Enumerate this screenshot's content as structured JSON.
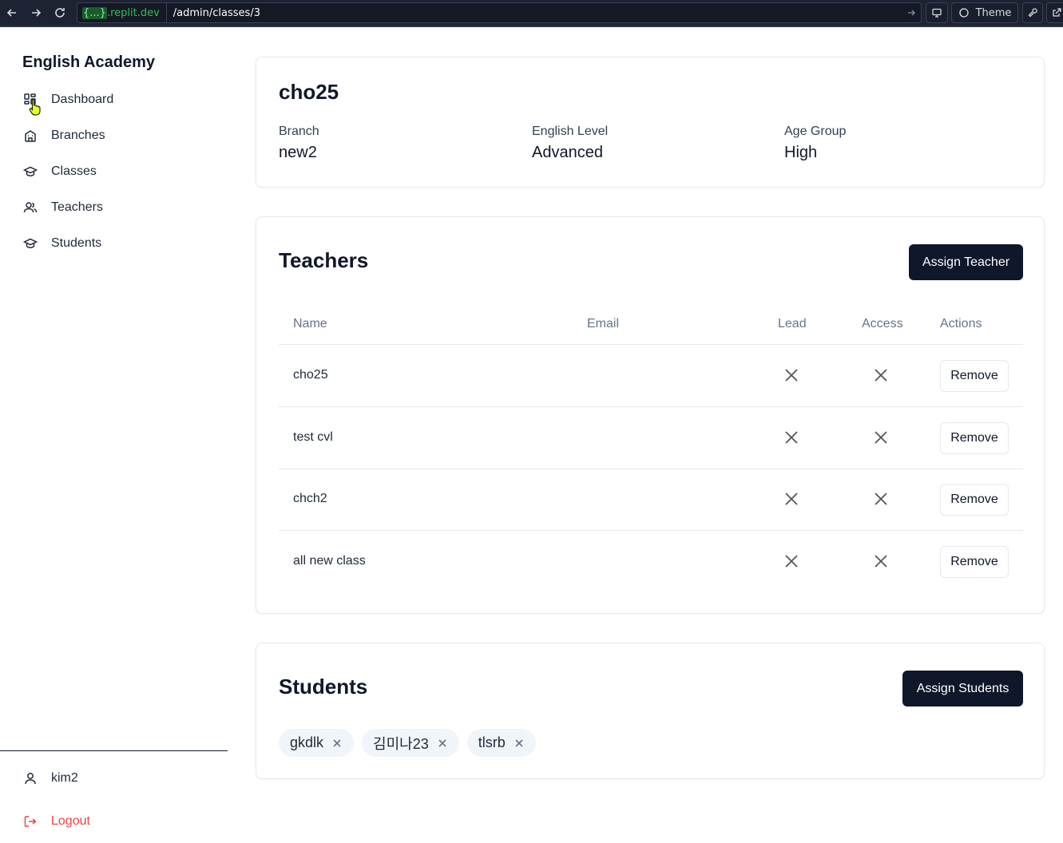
{
  "browser": {
    "domain_braces": "{...}",
    "domain_suffix": ".replit.dev",
    "path": "/admin/classes/3",
    "theme_label": "Theme"
  },
  "sidebar": {
    "brand": "English Academy",
    "items": [
      {
        "label": "Dashboard",
        "icon": "dashboard-icon"
      },
      {
        "label": "Branches",
        "icon": "building-icon"
      },
      {
        "label": "Classes",
        "icon": "graduation-cap-icon"
      },
      {
        "label": "Teachers",
        "icon": "users-icon"
      },
      {
        "label": "Students",
        "icon": "graduation-cap-icon"
      }
    ],
    "user": "kim2",
    "logout": "Logout"
  },
  "class_info": {
    "name": "cho25",
    "fields": [
      {
        "label": "Branch",
        "value": "new2"
      },
      {
        "label": "English Level",
        "value": "Advanced"
      },
      {
        "label": "Age Group",
        "value": "High"
      }
    ]
  },
  "teachers": {
    "title": "Teachers",
    "assign_label": "Assign Teacher",
    "columns": [
      "Name",
      "Email",
      "Lead",
      "Access",
      "Actions"
    ],
    "rows": [
      {
        "name": "cho25",
        "email": "",
        "lead": false,
        "access": false,
        "action": "Remove"
      },
      {
        "name": "test cvl",
        "email": "",
        "lead": false,
        "access": false,
        "action": "Remove"
      },
      {
        "name": "chch2",
        "email": "",
        "lead": false,
        "access": false,
        "action": "Remove"
      },
      {
        "name": "all new class",
        "email": "",
        "lead": false,
        "access": false,
        "action": "Remove"
      }
    ]
  },
  "students": {
    "title": "Students",
    "assign_label": "Assign Students",
    "chips": [
      "gkdlk",
      "김미나23",
      "tlsrb"
    ]
  },
  "colors": {
    "primary": "#0f172a",
    "danger": "#ef4444",
    "chip_bg": "#f1f5f9",
    "border": "#e5e7eb"
  }
}
